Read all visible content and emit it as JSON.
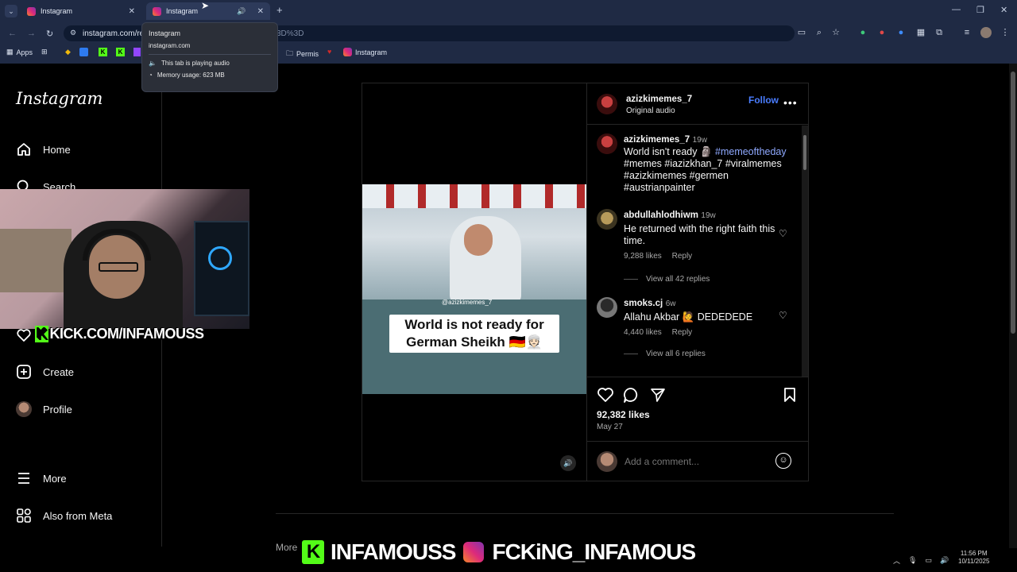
{
  "browser": {
    "tabs": [
      {
        "title": "Instagram"
      },
      {
        "title": "Instagram",
        "active": true
      }
    ],
    "new_tab_label": "+",
    "url_visible": "instagram.com/re",
    "url_tail": "3D%3D",
    "bookmarks": [
      "Apps",
      "Permis",
      "Instagram"
    ],
    "tooltip": {
      "title": "Instagram",
      "domain": "instagram.com",
      "audio": "This tab is playing audio",
      "memory": "Memory usage: 623 MB"
    }
  },
  "ig": {
    "logo": "Instagram",
    "nav": {
      "home": "Home",
      "search": "Search",
      "create": "Create",
      "profile": "Profile",
      "more": "More",
      "meta": "Also from Meta"
    }
  },
  "overlay": {
    "kick_text": "KICK.COM/INFAMOUSS",
    "bottom_kick": "INFAMOUSS",
    "bottom_ig": "FCKiNG_INFAMOUS"
  },
  "post": {
    "author": "azizkimemes_7",
    "audio": "Original audio",
    "follow": "Follow",
    "caption": {
      "username": "azizkimemes_7",
      "age": "19w",
      "text": "World isn't ready 🗿",
      "tags_line1": "#memeoftheday",
      "tags_line2": "#memes #iazizkhan_7 #viralmemes",
      "tags_line3": "#azizkimemes #germen",
      "tags_line4": "#austrianpainter"
    },
    "comments": [
      {
        "username": "abdullahlodhiwm",
        "age": "19w",
        "text": "He returned with the right faith this time.",
        "likes": "9,288 likes",
        "reply": "Reply",
        "view_replies": "View all 42 replies"
      },
      {
        "username": "smoks.cj",
        "age": "6w",
        "text": "Allahu Akbar 🙋 DEDEDEDE",
        "likes": "4,440 likes",
        "reply": "Reply",
        "view_replies": "View all 6 replies"
      }
    ],
    "likes": "92,382 likes",
    "date": "May 27",
    "comment_placeholder": "Add a comment...",
    "video": {
      "watermark": "@azizkimemes_7",
      "caption": "World is not ready for German Sheikh 🇩🇪👳🏻"
    }
  },
  "page": {
    "more_posts": "More"
  },
  "system": {
    "time": "11:56 PM",
    "date": "10/11/2025"
  }
}
